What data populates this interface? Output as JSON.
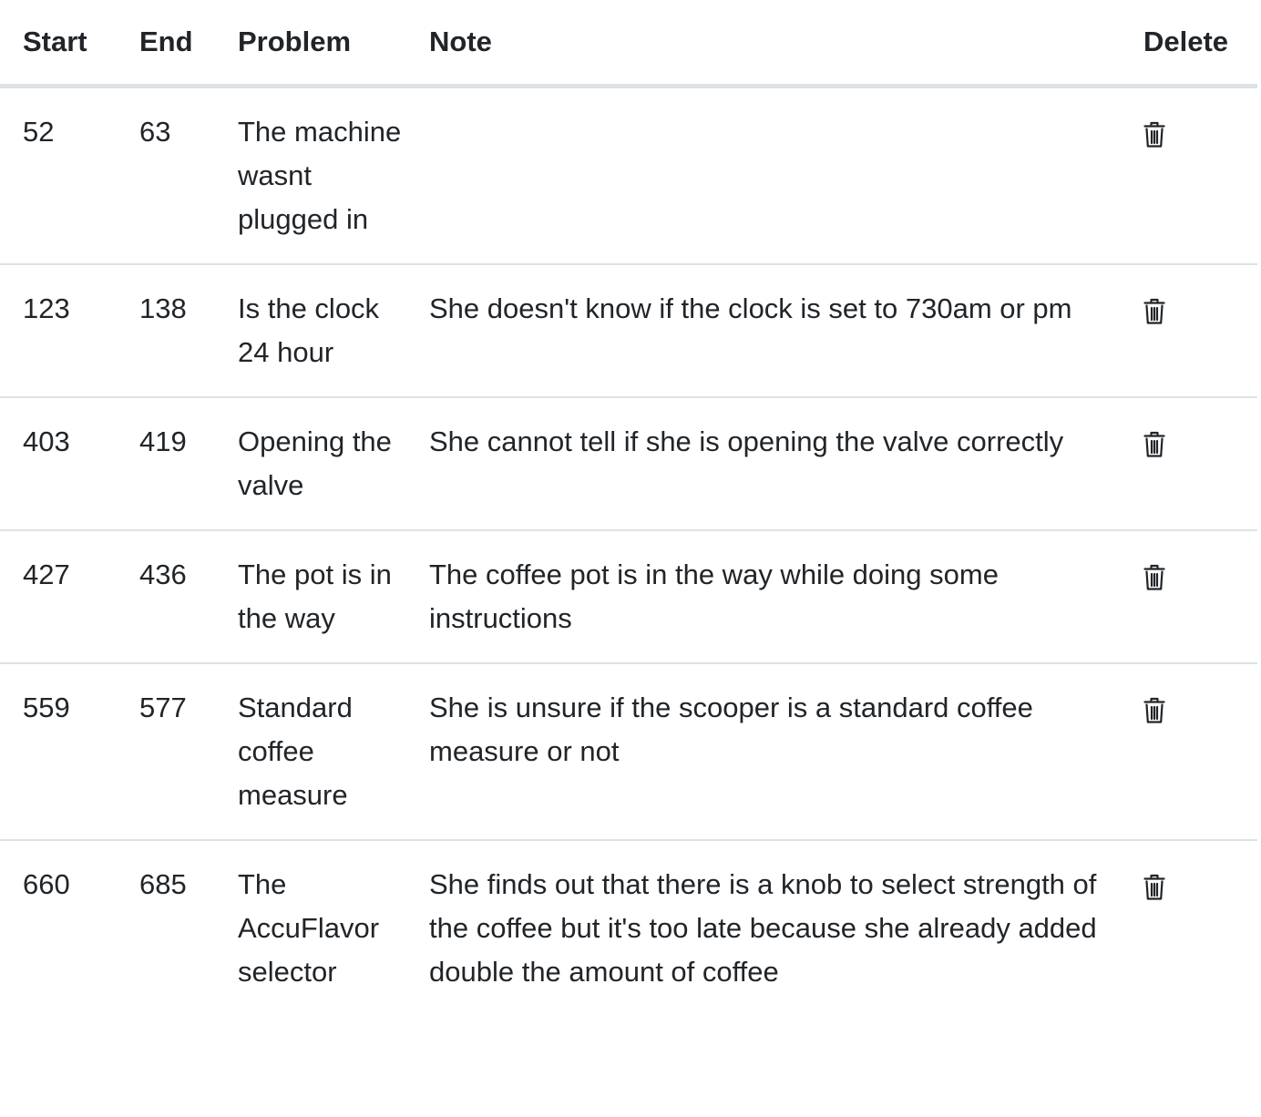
{
  "table": {
    "headers": {
      "start": "Start",
      "end": "End",
      "problem": "Problem",
      "note": "Note",
      "delete": "Delete"
    },
    "rows": [
      {
        "start": "52",
        "end": "63",
        "problem": "The machine wasnt plugged in",
        "note": "",
        "delete_icon": "trash-icon"
      },
      {
        "start": "123",
        "end": "138",
        "problem": "Is the clock 24 hour",
        "note": "She doesn't know if the clock is set to 730am or pm",
        "delete_icon": "trash-icon"
      },
      {
        "start": "403",
        "end": "419",
        "problem": "Opening the valve",
        "note": "She cannot tell if she is opening the valve correctly",
        "delete_icon": "trash-icon"
      },
      {
        "start": "427",
        "end": "436",
        "problem": "The pot is in the way",
        "note": "The coffee pot is in the way while doing some instructions",
        "delete_icon": "trash-icon"
      },
      {
        "start": "559",
        "end": "577",
        "problem": "Standard coffee measure",
        "note": "She is unsure if the scooper is a standard coffee measure or not",
        "delete_icon": "trash-icon"
      },
      {
        "start": "660",
        "end": "685",
        "problem": "The AccuFlavor selector",
        "note": "She finds out that there is a knob to select strength of the coffee but it's too late because she already added double the amount of coffee",
        "delete_icon": "trash-icon"
      }
    ]
  }
}
